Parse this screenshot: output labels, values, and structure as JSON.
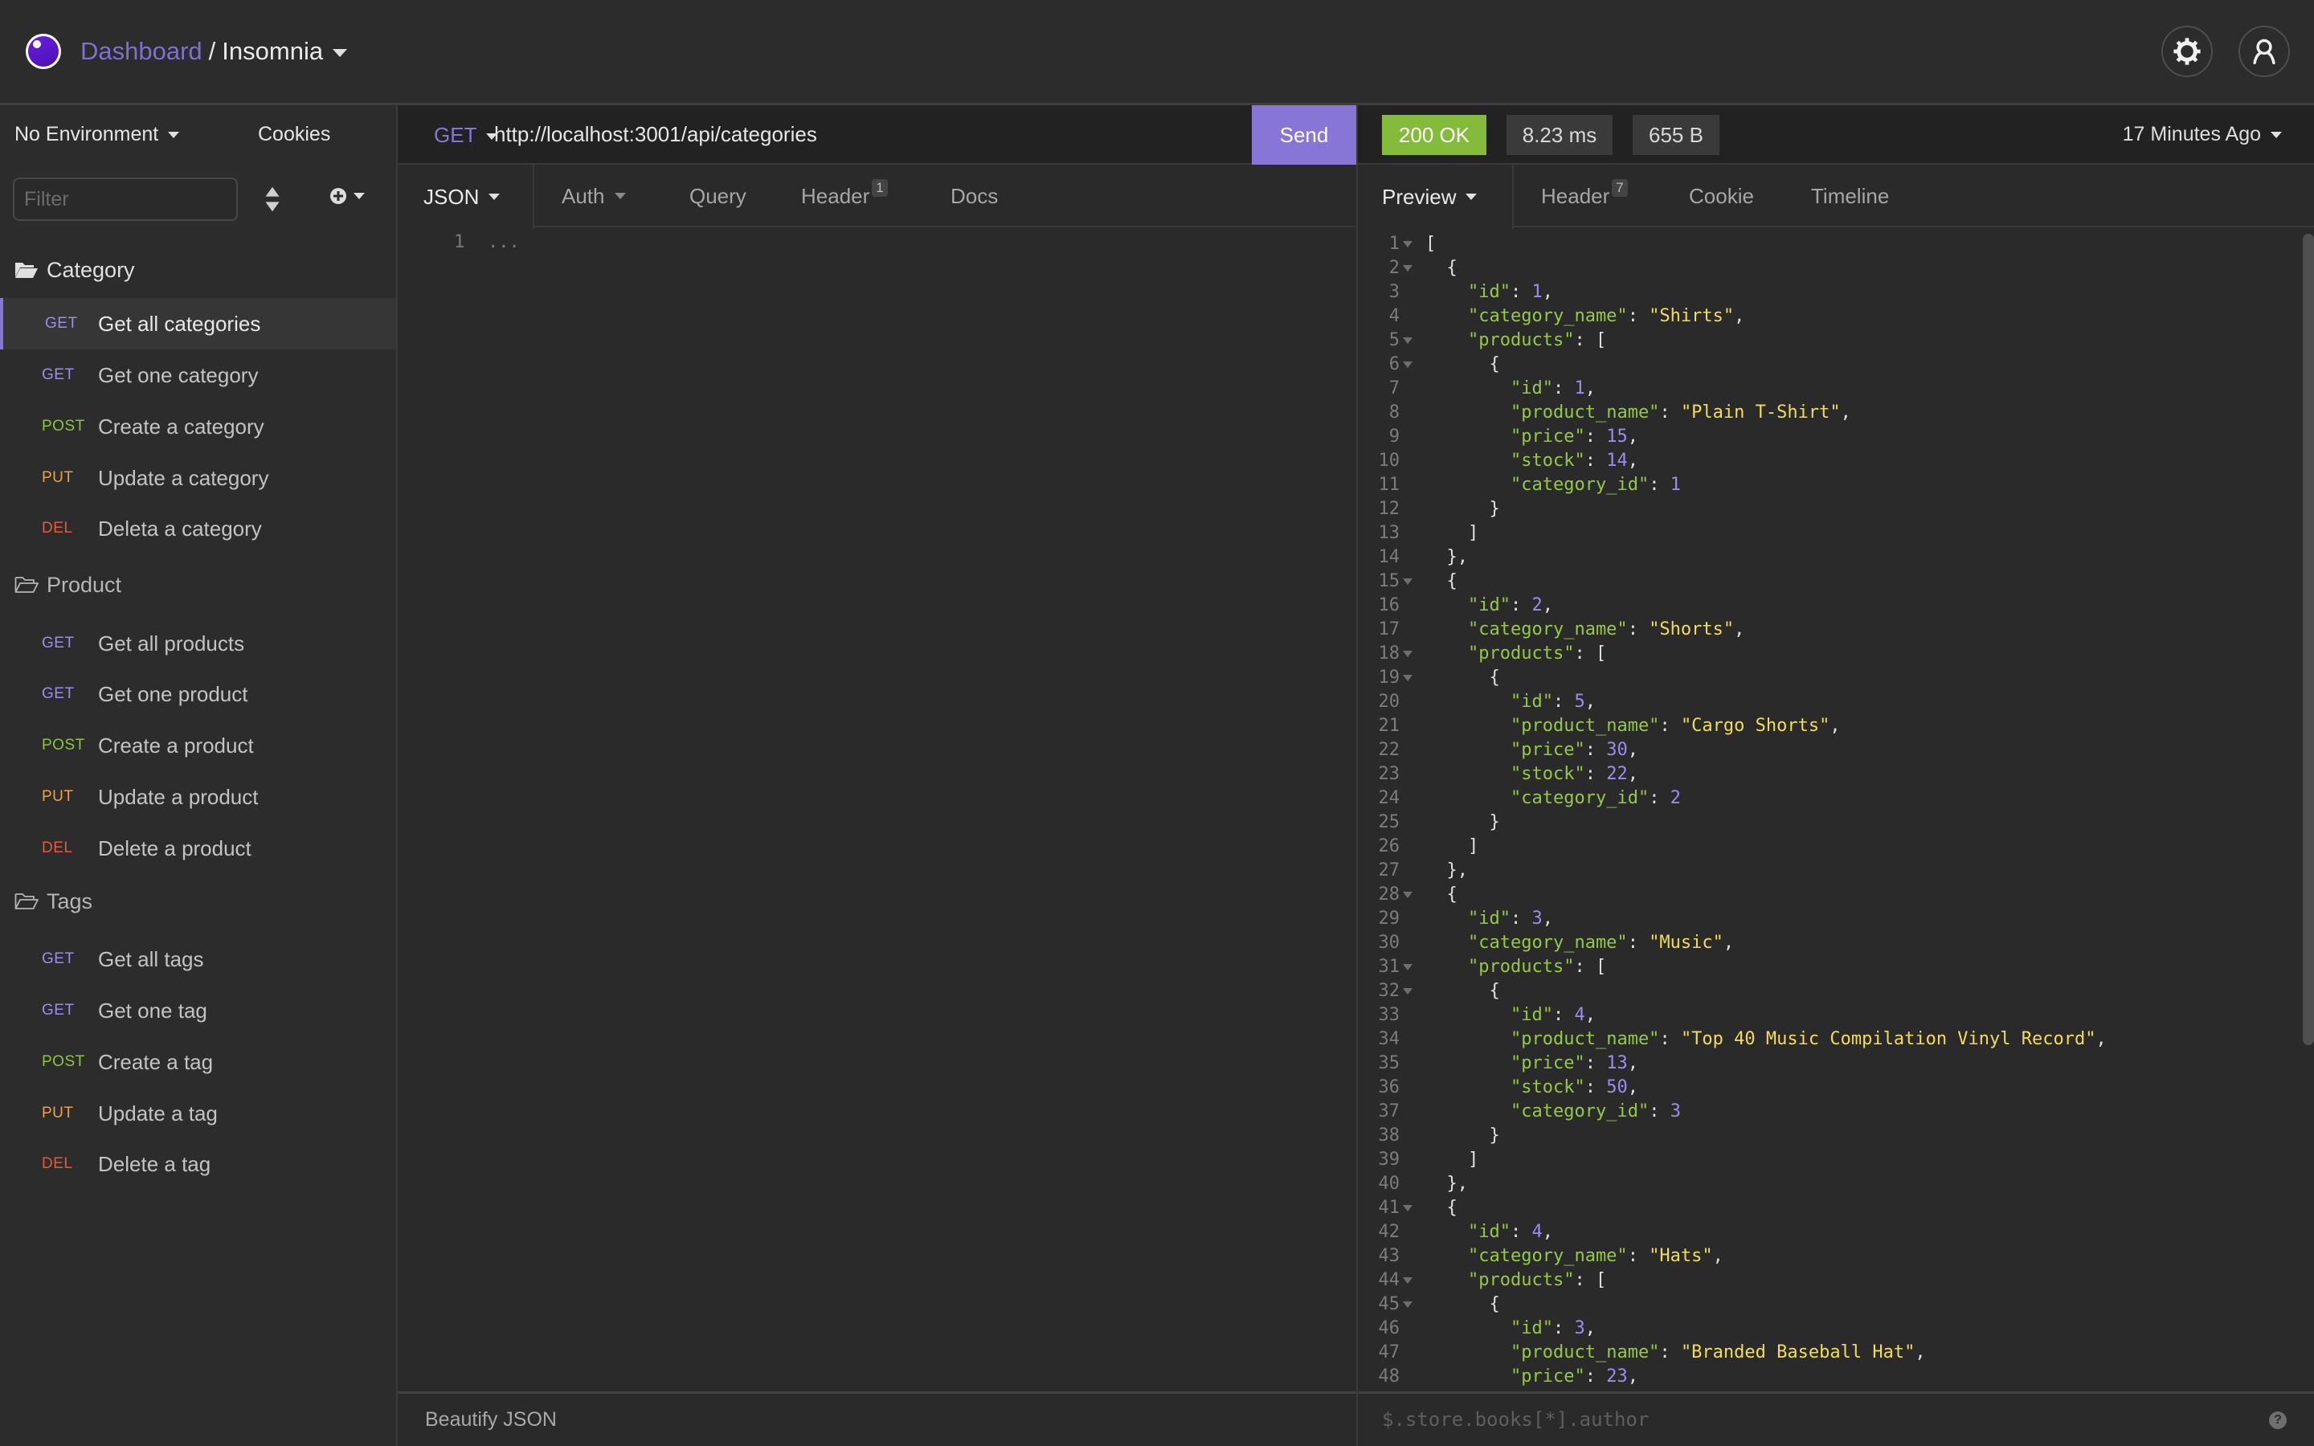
{
  "header": {
    "breadcrumb_root": "Dashboard",
    "separator": "/",
    "workspace": "Insomnia",
    "settings_icon": "gear-icon",
    "account_icon": "user-icon"
  },
  "sidebar": {
    "environment": "No Environment",
    "cookies": "Cookies",
    "filter_placeholder": "Filter",
    "filter_value": "",
    "folders": [
      {
        "name": "Category",
        "open": true,
        "requests": [
          {
            "method": "GET",
            "label": "Get all categories",
            "active": true
          },
          {
            "method": "GET",
            "label": "Get one category"
          },
          {
            "method": "POST",
            "label": "Create a category"
          },
          {
            "method": "PUT",
            "label": "Update a category"
          },
          {
            "method": "DEL",
            "label": "Deleta a category"
          }
        ]
      },
      {
        "name": "Product",
        "open": false,
        "requests": [
          {
            "method": "GET",
            "label": "Get all products"
          },
          {
            "method": "GET",
            "label": "Get one product"
          },
          {
            "method": "POST",
            "label": "Create a product"
          },
          {
            "method": "PUT",
            "label": "Update a product"
          },
          {
            "method": "DEL",
            "label": "Delete a product"
          }
        ]
      },
      {
        "name": "Tags",
        "open": false,
        "requests": [
          {
            "method": "GET",
            "label": "Get all tags"
          },
          {
            "method": "GET",
            "label": "Get one tag"
          },
          {
            "method": "POST",
            "label": "Create a tag"
          },
          {
            "method": "PUT",
            "label": "Update a tag"
          },
          {
            "method": "DEL",
            "label": "Delete a tag"
          }
        ]
      }
    ]
  },
  "request": {
    "method": "GET",
    "url": "http://localhost:3001/api/categories",
    "send_label": "Send",
    "tabs": [
      {
        "label": "JSON",
        "active": true,
        "dropdown": true
      },
      {
        "label": "Auth",
        "dropdown": true
      },
      {
        "label": "Query"
      },
      {
        "label": "Header",
        "badge": "1"
      },
      {
        "label": "Docs"
      }
    ],
    "body_line_number": "1",
    "body_placeholder": "...",
    "beautify_label": "Beautify JSON"
  },
  "response": {
    "status": "200 OK",
    "time": "8.23 ms",
    "size": "655 B",
    "history": "17 Minutes Ago",
    "tabs": [
      {
        "label": "Preview",
        "active": true,
        "dropdown": true
      },
      {
        "label": "Header",
        "badge": "7"
      },
      {
        "label": "Cookie"
      },
      {
        "label": "Timeline"
      }
    ],
    "filter_placeholder": "$.store.books[*].author",
    "help_label": "?",
    "lines": [
      {
        "indent": 0,
        "fold": true,
        "tokens": [
          [
            "p",
            "["
          ]
        ]
      },
      {
        "indent": 1,
        "fold": true,
        "tokens": [
          [
            "p",
            "{"
          ]
        ]
      },
      {
        "indent": 2,
        "tokens": [
          [
            "k",
            "\"id\""
          ],
          [
            "p",
            ": "
          ],
          [
            "num",
            "1"
          ],
          [
            "p",
            ","
          ]
        ]
      },
      {
        "indent": 2,
        "tokens": [
          [
            "k",
            "\"category_name\""
          ],
          [
            "p",
            ": "
          ],
          [
            "s",
            "\"Shirts\""
          ],
          [
            "p",
            ","
          ]
        ]
      },
      {
        "indent": 2,
        "fold": true,
        "tokens": [
          [
            "k",
            "\"products\""
          ],
          [
            "p",
            ": ["
          ]
        ]
      },
      {
        "indent": 3,
        "fold": true,
        "tokens": [
          [
            "p",
            "{"
          ]
        ]
      },
      {
        "indent": 4,
        "tokens": [
          [
            "k",
            "\"id\""
          ],
          [
            "p",
            ": "
          ],
          [
            "num",
            "1"
          ],
          [
            "p",
            ","
          ]
        ]
      },
      {
        "indent": 4,
        "tokens": [
          [
            "k",
            "\"product_name\""
          ],
          [
            "p",
            ": "
          ],
          [
            "s",
            "\"Plain T-Shirt\""
          ],
          [
            "p",
            ","
          ]
        ]
      },
      {
        "indent": 4,
        "tokens": [
          [
            "k",
            "\"price\""
          ],
          [
            "p",
            ": "
          ],
          [
            "num",
            "15"
          ],
          [
            "p",
            ","
          ]
        ]
      },
      {
        "indent": 4,
        "tokens": [
          [
            "k",
            "\"stock\""
          ],
          [
            "p",
            ": "
          ],
          [
            "num",
            "14"
          ],
          [
            "p",
            ","
          ]
        ]
      },
      {
        "indent": 4,
        "tokens": [
          [
            "k",
            "\"category_id\""
          ],
          [
            "p",
            ": "
          ],
          [
            "num",
            "1"
          ]
        ]
      },
      {
        "indent": 3,
        "tokens": [
          [
            "p",
            "}"
          ]
        ]
      },
      {
        "indent": 2,
        "tokens": [
          [
            "p",
            "]"
          ]
        ]
      },
      {
        "indent": 1,
        "tokens": [
          [
            "p",
            "},"
          ]
        ]
      },
      {
        "indent": 1,
        "fold": true,
        "tokens": [
          [
            "p",
            "{"
          ]
        ]
      },
      {
        "indent": 2,
        "tokens": [
          [
            "k",
            "\"id\""
          ],
          [
            "p",
            ": "
          ],
          [
            "num",
            "2"
          ],
          [
            "p",
            ","
          ]
        ]
      },
      {
        "indent": 2,
        "tokens": [
          [
            "k",
            "\"category_name\""
          ],
          [
            "p",
            ": "
          ],
          [
            "s",
            "\"Shorts\""
          ],
          [
            "p",
            ","
          ]
        ]
      },
      {
        "indent": 2,
        "fold": true,
        "tokens": [
          [
            "k",
            "\"products\""
          ],
          [
            "p",
            ": ["
          ]
        ]
      },
      {
        "indent": 3,
        "fold": true,
        "tokens": [
          [
            "p",
            "{"
          ]
        ]
      },
      {
        "indent": 4,
        "tokens": [
          [
            "k",
            "\"id\""
          ],
          [
            "p",
            ": "
          ],
          [
            "num",
            "5"
          ],
          [
            "p",
            ","
          ]
        ]
      },
      {
        "indent": 4,
        "tokens": [
          [
            "k",
            "\"product_name\""
          ],
          [
            "p",
            ": "
          ],
          [
            "s",
            "\"Cargo Shorts\""
          ],
          [
            "p",
            ","
          ]
        ]
      },
      {
        "indent": 4,
        "tokens": [
          [
            "k",
            "\"price\""
          ],
          [
            "p",
            ": "
          ],
          [
            "num",
            "30"
          ],
          [
            "p",
            ","
          ]
        ]
      },
      {
        "indent": 4,
        "tokens": [
          [
            "k",
            "\"stock\""
          ],
          [
            "p",
            ": "
          ],
          [
            "num",
            "22"
          ],
          [
            "p",
            ","
          ]
        ]
      },
      {
        "indent": 4,
        "tokens": [
          [
            "k",
            "\"category_id\""
          ],
          [
            "p",
            ": "
          ],
          [
            "num",
            "2"
          ]
        ]
      },
      {
        "indent": 3,
        "tokens": [
          [
            "p",
            "}"
          ]
        ]
      },
      {
        "indent": 2,
        "tokens": [
          [
            "p",
            "]"
          ]
        ]
      },
      {
        "indent": 1,
        "tokens": [
          [
            "p",
            "},"
          ]
        ]
      },
      {
        "indent": 1,
        "fold": true,
        "tokens": [
          [
            "p",
            "{"
          ]
        ]
      },
      {
        "indent": 2,
        "tokens": [
          [
            "k",
            "\"id\""
          ],
          [
            "p",
            ": "
          ],
          [
            "num",
            "3"
          ],
          [
            "p",
            ","
          ]
        ]
      },
      {
        "indent": 2,
        "tokens": [
          [
            "k",
            "\"category_name\""
          ],
          [
            "p",
            ": "
          ],
          [
            "s",
            "\"Music\""
          ],
          [
            "p",
            ","
          ]
        ]
      },
      {
        "indent": 2,
        "fold": true,
        "tokens": [
          [
            "k",
            "\"products\""
          ],
          [
            "p",
            ": ["
          ]
        ]
      },
      {
        "indent": 3,
        "fold": true,
        "tokens": [
          [
            "p",
            "{"
          ]
        ]
      },
      {
        "indent": 4,
        "tokens": [
          [
            "k",
            "\"id\""
          ],
          [
            "p",
            ": "
          ],
          [
            "num",
            "4"
          ],
          [
            "p",
            ","
          ]
        ]
      },
      {
        "indent": 4,
        "tokens": [
          [
            "k",
            "\"product_name\""
          ],
          [
            "p",
            ": "
          ],
          [
            "s",
            "\"Top 40 Music Compilation Vinyl Record\""
          ],
          [
            "p",
            ","
          ]
        ]
      },
      {
        "indent": 4,
        "tokens": [
          [
            "k",
            "\"price\""
          ],
          [
            "p",
            ": "
          ],
          [
            "num",
            "13"
          ],
          [
            "p",
            ","
          ]
        ]
      },
      {
        "indent": 4,
        "tokens": [
          [
            "k",
            "\"stock\""
          ],
          [
            "p",
            ": "
          ],
          [
            "num",
            "50"
          ],
          [
            "p",
            ","
          ]
        ]
      },
      {
        "indent": 4,
        "tokens": [
          [
            "k",
            "\"category_id\""
          ],
          [
            "p",
            ": "
          ],
          [
            "num",
            "3"
          ]
        ]
      },
      {
        "indent": 3,
        "tokens": [
          [
            "p",
            "}"
          ]
        ]
      },
      {
        "indent": 2,
        "tokens": [
          [
            "p",
            "]"
          ]
        ]
      },
      {
        "indent": 1,
        "tokens": [
          [
            "p",
            "},"
          ]
        ]
      },
      {
        "indent": 1,
        "fold": true,
        "tokens": [
          [
            "p",
            "{"
          ]
        ]
      },
      {
        "indent": 2,
        "tokens": [
          [
            "k",
            "\"id\""
          ],
          [
            "p",
            ": "
          ],
          [
            "num",
            "4"
          ],
          [
            "p",
            ","
          ]
        ]
      },
      {
        "indent": 2,
        "tokens": [
          [
            "k",
            "\"category_name\""
          ],
          [
            "p",
            ": "
          ],
          [
            "s",
            "\"Hats\""
          ],
          [
            "p",
            ","
          ]
        ]
      },
      {
        "indent": 2,
        "fold": true,
        "tokens": [
          [
            "k",
            "\"products\""
          ],
          [
            "p",
            ": ["
          ]
        ]
      },
      {
        "indent": 3,
        "fold": true,
        "tokens": [
          [
            "p",
            "{"
          ]
        ]
      },
      {
        "indent": 4,
        "tokens": [
          [
            "k",
            "\"id\""
          ],
          [
            "p",
            ": "
          ],
          [
            "num",
            "3"
          ],
          [
            "p",
            ","
          ]
        ]
      },
      {
        "indent": 4,
        "tokens": [
          [
            "k",
            "\"product_name\""
          ],
          [
            "p",
            ": "
          ],
          [
            "s",
            "\"Branded Baseball Hat\""
          ],
          [
            "p",
            ","
          ]
        ]
      },
      {
        "indent": 4,
        "tokens": [
          [
            "k",
            "\"price\""
          ],
          [
            "p",
            ": "
          ],
          [
            "num",
            "23"
          ],
          [
            "p",
            ","
          ]
        ]
      }
    ]
  },
  "colors": {
    "accent": "#8776d5",
    "get": "#9b8cf0",
    "post": "#88c83a",
    "put": "#eda23b",
    "del": "#e45a3a",
    "status_ok": "#84bb3b"
  }
}
